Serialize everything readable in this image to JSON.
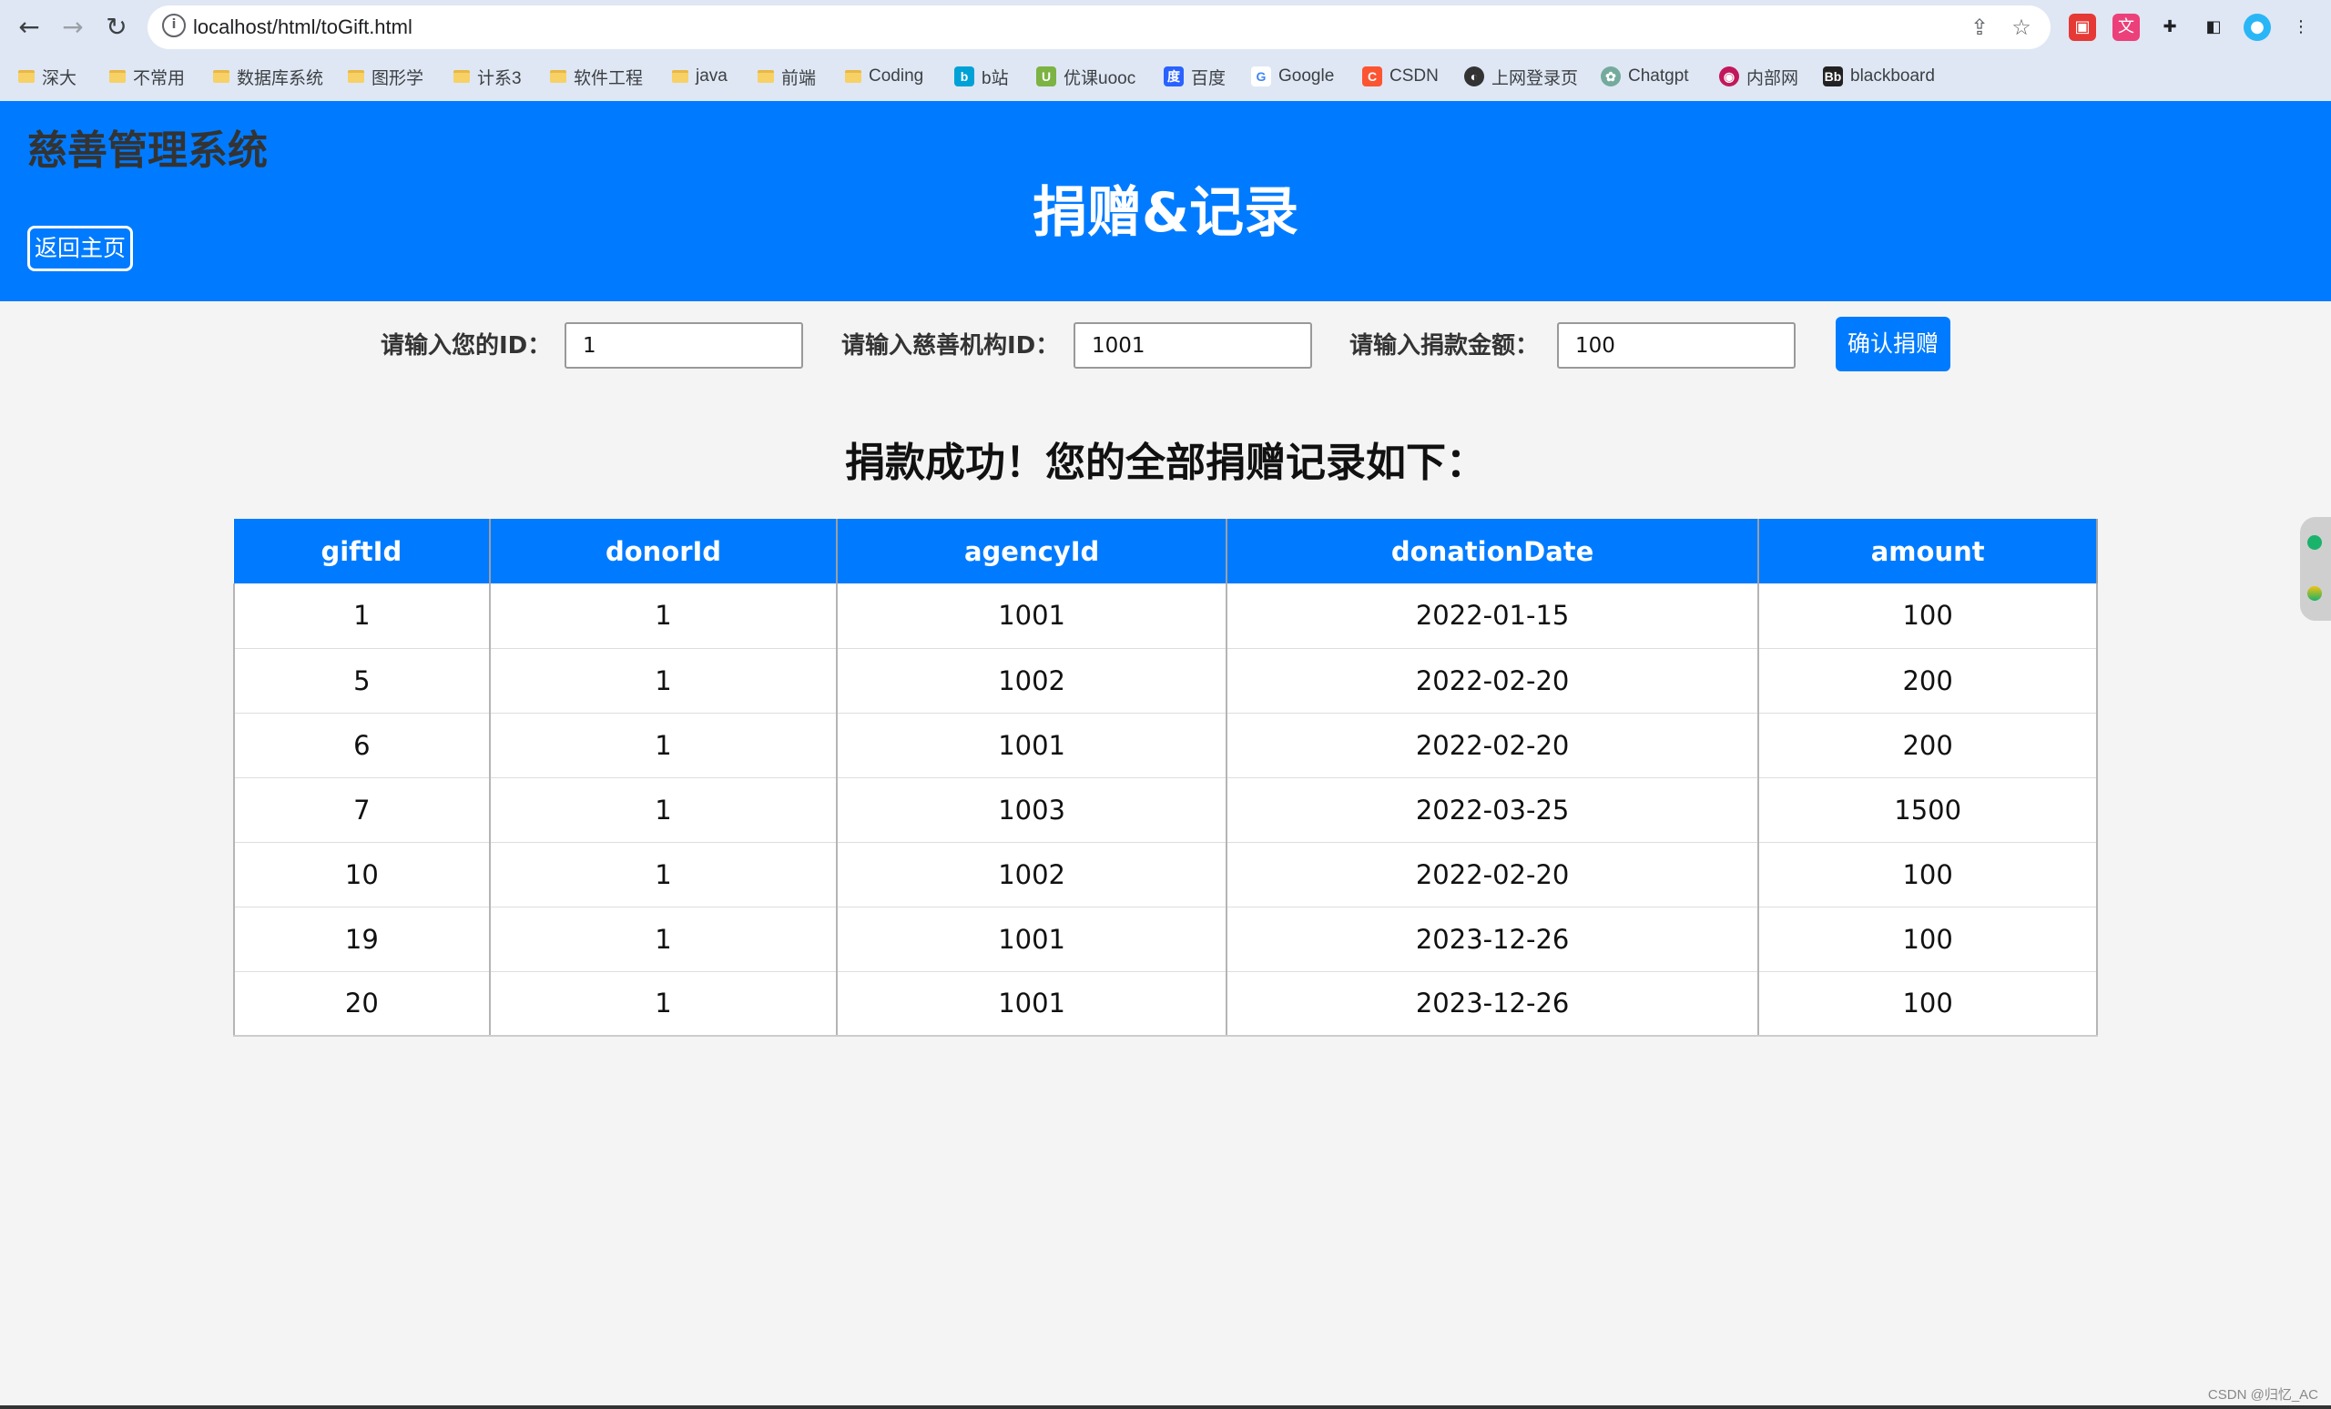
{
  "browser": {
    "url": "localhost/html/toGift.html",
    "bookmarks": [
      "深大",
      "不常用",
      "数据库系统",
      "图形学",
      "计系3",
      "软件工程",
      "java",
      "前端",
      "Coding",
      "b站",
      "优课uooc",
      "百度",
      "Google",
      "CSDN",
      "上网登录页",
      "Chatgpt",
      "内部网",
      "blackboard"
    ]
  },
  "header": {
    "system_name": "慈善管理系统",
    "back_label": "返回主页",
    "page_title": "捐赠&记录"
  },
  "form": {
    "donor_label": "请输入您的ID：",
    "donor_value": "1",
    "agency_label": "请输入慈善机构ID：",
    "agency_value": "1001",
    "amount_label": "请输入捐款金额：",
    "amount_value": "100",
    "submit_label": "确认捐赠"
  },
  "result_message": "捐款成功！您的全部捐赠记录如下：",
  "table": {
    "headers": [
      "giftId",
      "donorId",
      "agencyId",
      "donationDate",
      "amount"
    ],
    "rows": [
      [
        "1",
        "1",
        "1001",
        "2022-01-15",
        "100"
      ],
      [
        "5",
        "1",
        "1002",
        "2022-02-20",
        "200"
      ],
      [
        "6",
        "1",
        "1001",
        "2022-02-20",
        "200"
      ],
      [
        "7",
        "1",
        "1003",
        "2022-03-25",
        "1500"
      ],
      [
        "10",
        "1",
        "1002",
        "2022-02-20",
        "100"
      ],
      [
        "19",
        "1",
        "1001",
        "2023-12-26",
        "100"
      ],
      [
        "20",
        "1",
        "1001",
        "2023-12-26",
        "100"
      ]
    ]
  },
  "watermark": "CSDN @归忆_AC",
  "colors": {
    "primary": "#007bff",
    "page_bg": "#f4f4f4",
    "system_name": "#333333"
  }
}
